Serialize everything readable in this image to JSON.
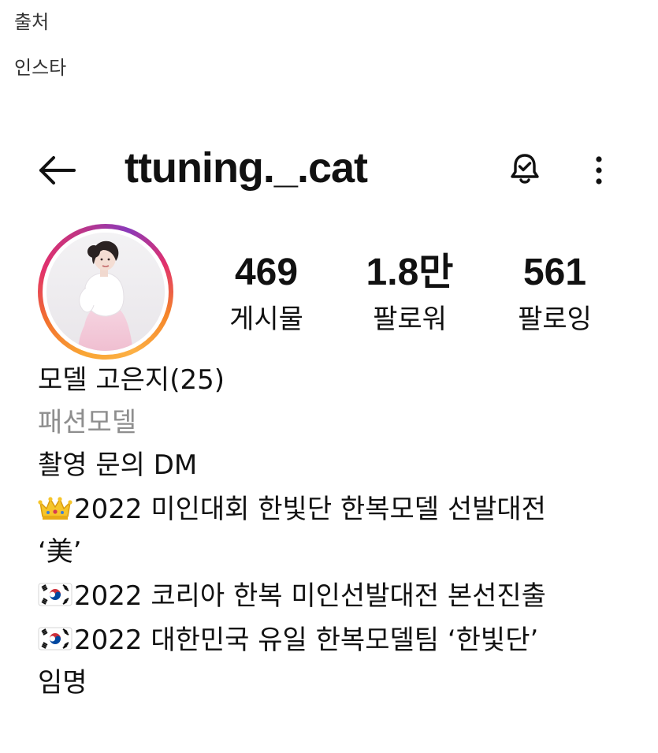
{
  "source": {
    "title": "출처",
    "value": "인스타"
  },
  "header": {
    "username": "ttuning._.cat",
    "icons": {
      "back": "arrow-left-icon",
      "notifications": "bell-check-icon",
      "more": "vertical-dots-icon"
    }
  },
  "stats": [
    {
      "value": "469",
      "label": "게시물"
    },
    {
      "value": "1.8만",
      "label": "팔로워"
    },
    {
      "value": "561",
      "label": "팔로잉"
    }
  ],
  "bio": {
    "name": "모델 고은지(25)",
    "category": "패션모델",
    "lines": [
      "촬영 문의 DM",
      "2022 미인대회 한빛단 한복모델 선발대전",
      "‘美’",
      "2022 코리아 한복 미인선발대전 본선진출",
      "2022 대한민국 유일 한복모델팀 ‘한빛단’",
      "임명"
    ],
    "line_icons": [
      "",
      "crown-emoji",
      "",
      "korea-flag-emoji",
      "korea-flag-emoji",
      ""
    ]
  },
  "colors": {
    "text": "#111111",
    "muted": "#8e8e8e",
    "story_ring_start": "#f9a534",
    "story_ring_mid": "#e1306c",
    "story_ring_end": "#8a3ab9"
  }
}
